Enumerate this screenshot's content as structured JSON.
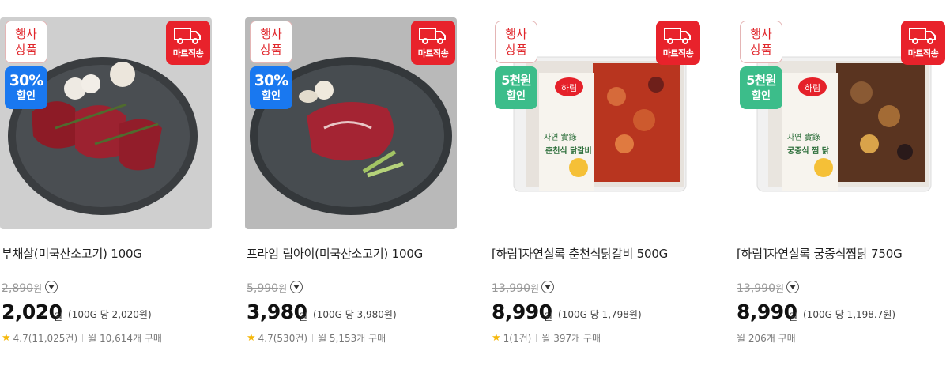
{
  "products": [
    {
      "event_badge": [
        "행사",
        "상품"
      ],
      "mart_badge": "마트직송",
      "discount": {
        "big": "30%",
        "small": "할인",
        "color": "#1978f0"
      },
      "name": "부채살(미국산소고기) 100G",
      "original_price": "2,890",
      "original_unit": "원",
      "price": "2,020",
      "price_unit": "원",
      "unit_price": "(100G 당 2,020원)",
      "rating": "4.7(11,025건)",
      "monthly": "월 10,614개 구매"
    },
    {
      "event_badge": [
        "행사",
        "상품"
      ],
      "mart_badge": "마트직송",
      "discount": {
        "big": "30%",
        "small": "할인",
        "color": "#1978f0"
      },
      "name": "프라임 립아이(미국산소고기) 100G",
      "original_price": "5,990",
      "original_unit": "원",
      "price": "3,980",
      "price_unit": "원",
      "unit_price": "(100G 당 3,980원)",
      "rating": "4.7(530건)",
      "monthly": "월 5,153개 구매"
    },
    {
      "event_badge": [
        "행사",
        "상품"
      ],
      "mart_badge": "마트직송",
      "discount": {
        "big": "5천원",
        "small": "할인",
        "color": "#3cbd8a"
      },
      "name": "[하림]자연실록 춘천식닭갈비 500G",
      "original_price": "13,990",
      "original_unit": "원",
      "price": "8,990",
      "price_unit": "원",
      "unit_price": "(100G 당 1,798원)",
      "rating": "1(1건)",
      "monthly": "월 397개 구매",
      "package_brand": "하림",
      "package_title": "춘천식 닭갈비",
      "package_sub": "자연 實錄"
    },
    {
      "event_badge": [
        "행사",
        "상품"
      ],
      "mart_badge": "마트직송",
      "discount": {
        "big": "5천원",
        "small": "할인",
        "color": "#3cbd8a"
      },
      "name": "[하림]자연실록 궁중식찜닭 750G",
      "original_price": "13,990",
      "original_unit": "원",
      "price": "8,990",
      "price_unit": "원",
      "unit_price": "(100G 당 1,198.7원)",
      "monthly": "월 206개 구매",
      "package_brand": "하림",
      "package_title": "궁중식 찜 닭",
      "package_sub": "자연 實錄"
    }
  ]
}
